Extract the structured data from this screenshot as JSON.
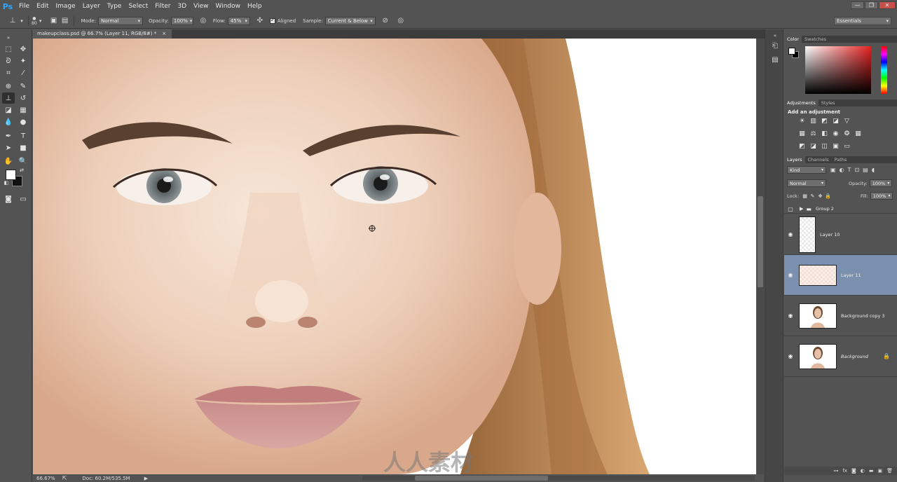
{
  "app": {
    "logo": "Ps"
  },
  "menu": [
    "File",
    "Edit",
    "Image",
    "Layer",
    "Type",
    "Select",
    "Filter",
    "3D",
    "View",
    "Window",
    "Help"
  ],
  "window_controls": [
    "—",
    "❐",
    "✕"
  ],
  "options": {
    "brush_size": "80",
    "mode_label": "Mode:",
    "mode_value": "Normal",
    "opacity_label": "Opacity:",
    "opacity_value": "100%",
    "flow_label": "Flow:",
    "flow_value": "45%",
    "aligned_label": "Aligned",
    "aligned_checked": true,
    "sample_label": "Sample:",
    "sample_value": "Current & Below",
    "workspace": "Essentials"
  },
  "document": {
    "tab_title": "makeupclass.psd @ 66.7% (Layer 11, RGB/8#) *",
    "tab_close": "×"
  },
  "status": {
    "zoom": "66.67%",
    "doc_info": "Doc: 60.2M/535.5M"
  },
  "color_panel": {
    "tabs": [
      "Color",
      "Swatches"
    ],
    "foreground": "#ffffff",
    "background": "#000000"
  },
  "adjustments_panel": {
    "tabs": [
      "Adjustments",
      "Styles"
    ],
    "title": "Add an adjustment"
  },
  "layers_panel": {
    "tabs": [
      "Layers",
      "Channels",
      "Paths"
    ],
    "filter_kind": "Kind",
    "blend_mode": "Normal",
    "opacity_label": "Opacity:",
    "opacity_value": "100%",
    "lock_label": "Lock:",
    "fill_label": "Fill:",
    "fill_value": "100%",
    "layers": [
      {
        "name": "Group 2",
        "type": "group",
        "visible": false,
        "selected": false
      },
      {
        "name": "Layer 10",
        "type": "layer",
        "visible": true,
        "selected": false
      },
      {
        "name": "Layer 11",
        "type": "layer",
        "visible": true,
        "selected": true
      },
      {
        "name": "Background copy 3",
        "type": "photo",
        "visible": true,
        "selected": false
      },
      {
        "name": "Background",
        "type": "photo",
        "visible": true,
        "selected": false,
        "locked": true
      }
    ],
    "footer_icons": [
      "link-icon",
      "fx-icon",
      "mask-icon",
      "adjustment-icon",
      "folder-icon",
      "new-layer-icon",
      "trash-icon"
    ]
  },
  "watermark": "人人素材"
}
